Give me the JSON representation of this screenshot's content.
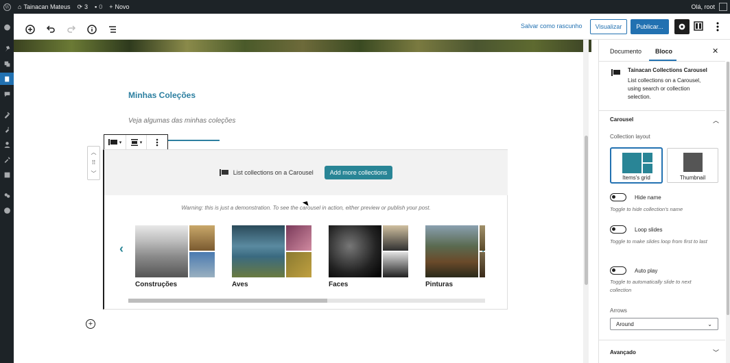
{
  "admin_bar": {
    "site_name": "Tainacan Mateus",
    "updates_count": "3",
    "comments_count": "0",
    "new_label": "Novo",
    "greeting": "Olá, root"
  },
  "toolbar": {
    "save_draft_label": "Salvar como rascunho",
    "preview_label": "Visualizar",
    "publish_label": "Publicar..."
  },
  "content": {
    "heading": "Minhas Coleções",
    "subtext": "Veja algumas das minhas coleções"
  },
  "block": {
    "header_label": "List collections on a Carousel",
    "add_more_label": "Add more collections",
    "warning": "Warning: this is just a demonstration. To see the carousel in action, either preview or publish your post.",
    "collections": [
      {
        "name": "Construções"
      },
      {
        "name": "Aves"
      },
      {
        "name": "Faces"
      },
      {
        "name": "Pinturas"
      }
    ]
  },
  "sidebar": {
    "tabs": [
      "Documento",
      "Bloco"
    ],
    "active_tab": "Bloco",
    "block_title": "Tainacan Collections Carousel",
    "block_description": "List collections on a Carousel, using search or collection selection.",
    "carousel_panel": "Carousel",
    "collection_layout_label": "Collection layout",
    "layout_options": [
      "Items's grid",
      "Thumbnail"
    ],
    "toggles": [
      {
        "label": "Hide name",
        "help": "Toggle to hide collection's name"
      },
      {
        "label": "Loop slides",
        "help": "Toggle to make slides loop from first to last"
      },
      {
        "label": "Auto play",
        "help": "Toggle to automatically slide to next collection"
      }
    ],
    "arrows_label": "Arrows",
    "arrows_value": "Around",
    "advanced_panel": "Avançado"
  },
  "colors": {
    "accent": "#298596",
    "wp_blue": "#2271b1",
    "admin_dark": "#1d2327"
  }
}
